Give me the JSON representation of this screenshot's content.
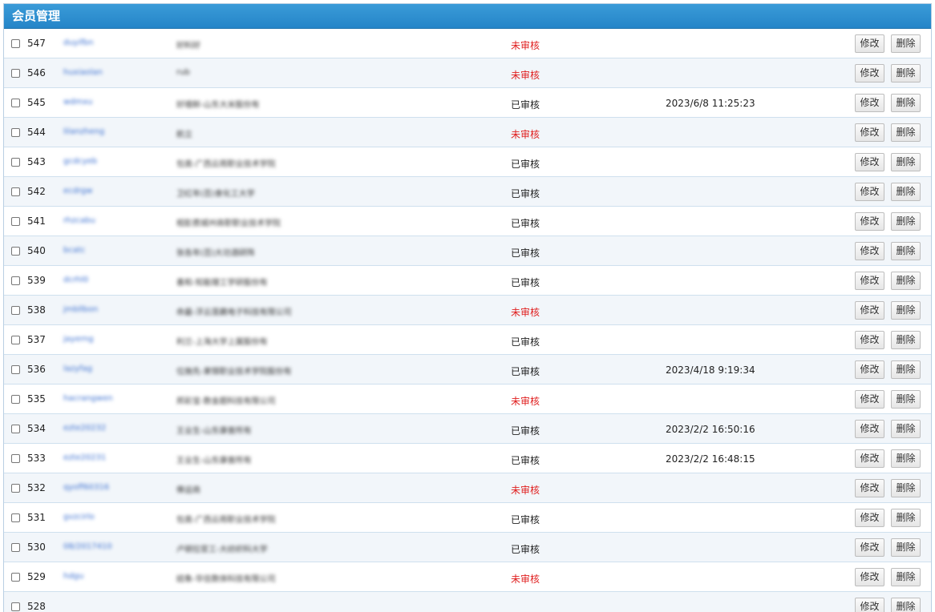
{
  "header": {
    "title": "会员管理"
  },
  "actions": {
    "edit_label": "修改",
    "delete_label": "删除"
  },
  "rows": [
    {
      "id": "547",
      "username": "duyifbn",
      "company": "好料好",
      "status": "未审核",
      "pending": true,
      "date": ""
    },
    {
      "id": "546",
      "username": "huxiaolan",
      "company": "rub",
      "status": "未审核",
      "pending": true,
      "date": ""
    },
    {
      "id": "545",
      "username": "wdmxu",
      "company": "好禧鲜-山东大米股份有",
      "status": "已审核",
      "pending": false,
      "date": "2023/6/8 11:25:23"
    },
    {
      "id": "544",
      "username": "lilanzheng",
      "company": "航立",
      "status": "未审核",
      "pending": true,
      "date": ""
    },
    {
      "id": "543",
      "username": "gcdcyeb",
      "company": "包类-广西云雨职业技术学院",
      "status": "已审核",
      "pending": false,
      "date": ""
    },
    {
      "id": "542",
      "username": "ecdrgw",
      "company": "卫红年(百)食化工大学",
      "status": "已审核",
      "pending": false,
      "date": ""
    },
    {
      "id": "541",
      "username": "rhzcabu",
      "company": "相彭费城州商职职业技术学院",
      "status": "已审核",
      "pending": false,
      "date": ""
    },
    {
      "id": "540",
      "username": "bcatc",
      "company": "张各年(百)大功酒研阵",
      "status": "已审核",
      "pending": false,
      "date": ""
    },
    {
      "id": "539",
      "username": "dcrhl0",
      "company": "善和-知能理工学研股份有",
      "status": "已审核",
      "pending": false,
      "date": ""
    },
    {
      "id": "538",
      "username": "jmbllbon",
      "company": "命最-浮云莲藕电子科技有限公司",
      "status": "未审核",
      "pending": true,
      "date": ""
    },
    {
      "id": "537",
      "username": "jayerng",
      "company": "利兰-上海大学上属股份有",
      "status": "已审核",
      "pending": false,
      "date": ""
    },
    {
      "id": "536",
      "username": "lazyfag",
      "company": "位施先-果锦职业技术学院股份有",
      "status": "已审核",
      "pending": false,
      "date": "2023/4/18 9:19:34"
    },
    {
      "id": "535",
      "username": "hacrangwen",
      "company": "邦彩宝-数金题科技有限公司",
      "status": "未审核",
      "pending": true,
      "date": ""
    },
    {
      "id": "534",
      "username": "ezte20232",
      "company": "王业生-山东康普所有",
      "status": "已审核",
      "pending": false,
      "date": "2023/2/2 16:50:16"
    },
    {
      "id": "533",
      "username": "ezte20231",
      "company": "王业生-山东康普所有",
      "status": "已审核",
      "pending": false,
      "date": "2023/2/2 16:48:15"
    },
    {
      "id": "532",
      "username": "qyoff60316",
      "company": "俸运商",
      "status": "未审核",
      "pending": true,
      "date": ""
    },
    {
      "id": "531",
      "username": "gvzcirlo",
      "company": "包类-广西云雨职业技术学院",
      "status": "已审核",
      "pending": false,
      "date": ""
    },
    {
      "id": "530",
      "username": "08/2017410",
      "company": "卢顿拉官工-大纺织科大学",
      "status": "已审核",
      "pending": false,
      "date": ""
    },
    {
      "id": "529",
      "username": "hdgu",
      "company": "结象-华信数体科技有限公司",
      "status": "未审核",
      "pending": true,
      "date": ""
    },
    {
      "id": "528",
      "username": "",
      "company": "",
      "status": "",
      "pending": false,
      "date": ""
    }
  ]
}
